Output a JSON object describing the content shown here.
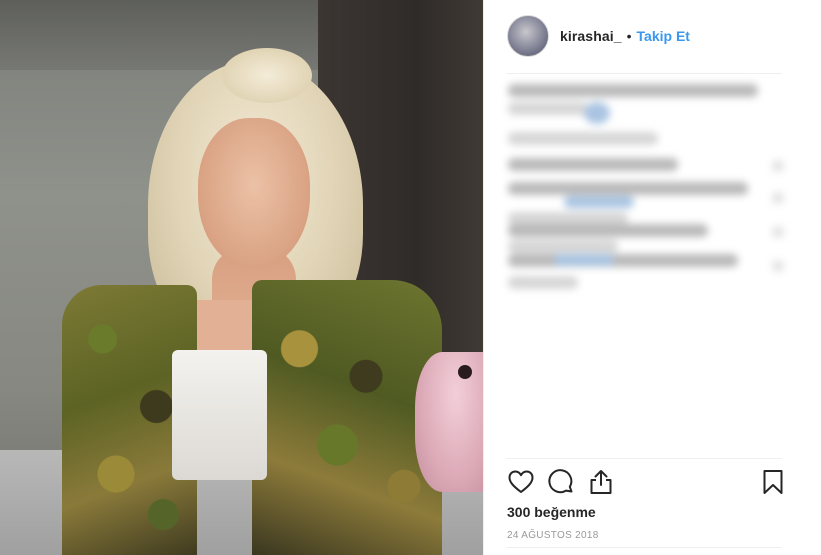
{
  "post": {
    "author": {
      "username": "kirashai_",
      "separator": "•",
      "follow_label": "Takip Et"
    },
    "actions": {
      "like_icon": "heart-icon",
      "comment_icon": "speech-bubble-icon",
      "share_icon": "share-icon",
      "save_icon": "bookmark-icon"
    },
    "likes_text": "300 beğenme",
    "date_text": "24 AĞUSTOS 2018"
  },
  "colors": {
    "accent": "#3897f0",
    "text": "#262626",
    "muted": "#999999",
    "divider": "#efefef"
  }
}
